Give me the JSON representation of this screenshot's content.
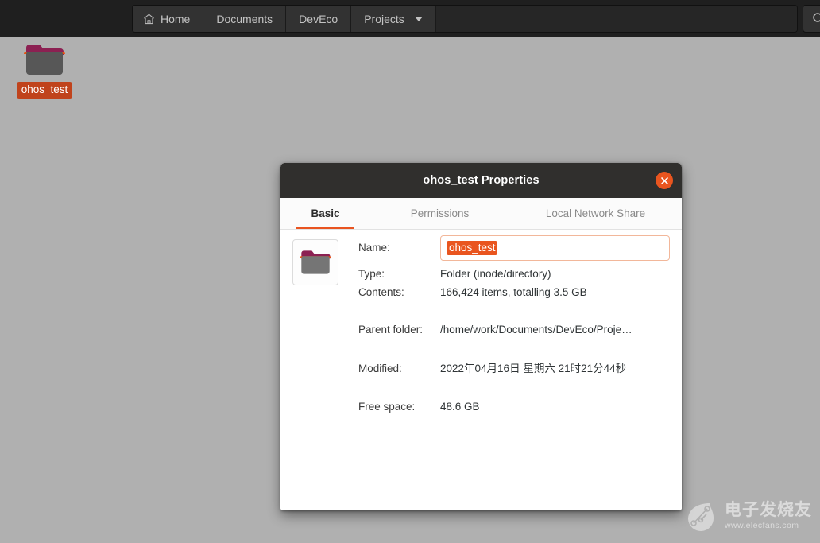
{
  "desktop": {
    "background_color": "#b0b0b0",
    "icon": {
      "name": "ohos_test",
      "icon_glyph": "folder-icon",
      "selected": true,
      "selection_color": "#c0431c"
    }
  },
  "topbar": {
    "background_color": "#1f1f1f",
    "breadcrumbs": [
      {
        "label": "Home",
        "icon": "home-icon",
        "has_dropdown": false
      },
      {
        "label": "Documents",
        "icon": "",
        "has_dropdown": false
      },
      {
        "label": "DevEco",
        "icon": "",
        "has_dropdown": false
      },
      {
        "label": "Projects",
        "icon": "",
        "has_dropdown": true
      }
    ],
    "search": {
      "icon": "search-icon",
      "label": ""
    }
  },
  "dialog": {
    "title": "ohos_test Properties",
    "close_label": "close-icon",
    "accent_color": "#e95420",
    "tabs": [
      {
        "label": "Basic",
        "active": true
      },
      {
        "label": "Permissions",
        "active": false
      },
      {
        "label": "Local Network Share",
        "active": false
      }
    ],
    "thumbnail_icon": "folder-icon",
    "fields": {
      "name_label": "Name:",
      "name_value": "ohos_test",
      "type_label": "Type:",
      "type_value": "Folder (inode/directory)",
      "contents_label": "Contents:",
      "contents_value": "166,424 items, totalling 3.5 GB",
      "parent_label": "Parent folder:",
      "parent_value": "/home/work/Documents/DevEco/Proje…",
      "modified_label": "Modified:",
      "modified_value": "2022年04月16日 星期六 21时21分44秒",
      "free_label": "Free space:",
      "free_value": "48.6 GB"
    }
  },
  "watermark": {
    "title": "电子发烧友",
    "url": "www.elecfans.com",
    "logo_icon": "leaf-circuit-logo-icon"
  }
}
